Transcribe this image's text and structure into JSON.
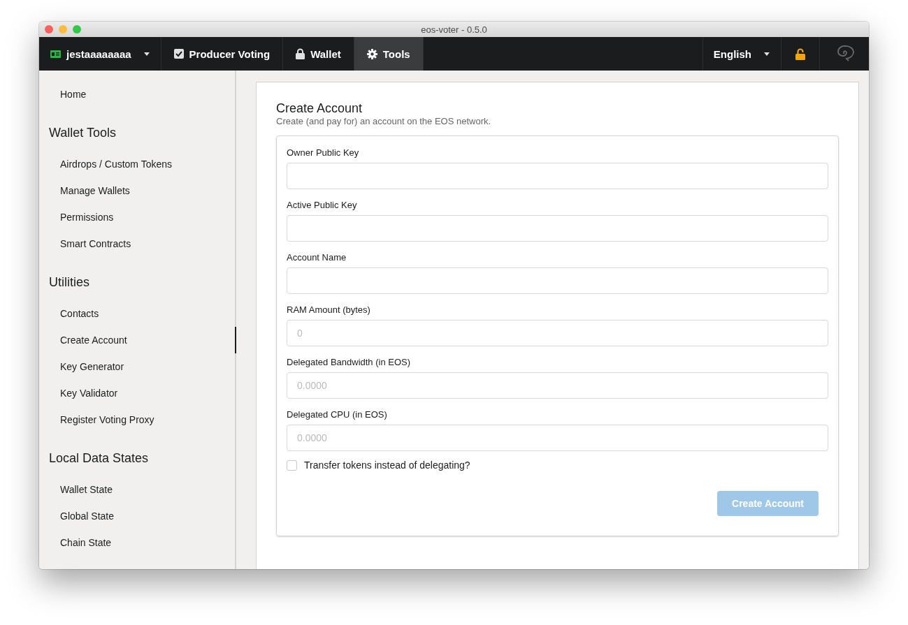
{
  "window": {
    "title": "eos-voter - 0.5.0"
  },
  "nav": {
    "account": "jestaaaaaaaa",
    "tabs": [
      {
        "label": "Producer Voting",
        "kind": "check",
        "selected": false
      },
      {
        "label": "Wallet",
        "kind": "lock",
        "selected": false
      },
      {
        "label": "Tools",
        "kind": "gear",
        "selected": true
      }
    ],
    "language": "English"
  },
  "sidebar": [
    {
      "items": [
        {
          "label": "Home",
          "selected": false
        }
      ]
    },
    {
      "heading": "Wallet Tools",
      "items": [
        {
          "label": "Airdrops / Custom Tokens",
          "selected": false
        },
        {
          "label": "Manage Wallets",
          "selected": false
        },
        {
          "label": "Permissions",
          "selected": false
        },
        {
          "label": "Smart Contracts",
          "selected": false
        }
      ]
    },
    {
      "heading": "Utilities",
      "items": [
        {
          "label": "Contacts",
          "selected": false
        },
        {
          "label": "Create Account",
          "selected": true
        },
        {
          "label": "Key Generator",
          "selected": false
        },
        {
          "label": "Key Validator",
          "selected": false
        },
        {
          "label": "Register Voting Proxy",
          "selected": false
        }
      ]
    },
    {
      "heading": "Local Data States",
      "items": [
        {
          "label": "Wallet State",
          "selected": false
        },
        {
          "label": "Global State",
          "selected": false
        },
        {
          "label": "Chain State",
          "selected": false
        }
      ]
    }
  ],
  "form": {
    "title": "Create Account",
    "subtitle": "Create (and pay for) an account on the EOS network.",
    "fields": [
      {
        "label": "Owner Public Key"
      },
      {
        "label": "Active Public Key"
      },
      {
        "label": "Account Name"
      },
      {
        "label": "RAM Amount (bytes)",
        "placeholder": "0"
      },
      {
        "label": "Delegated Bandwidth (in EOS)",
        "placeholder": "0.0000"
      },
      {
        "label": "Delegated CPU (in EOS)",
        "placeholder": "0.0000"
      }
    ],
    "checkbox": {
      "label": "Transfer tokens instead of delegating?",
      "checked": false
    },
    "button": {
      "label": "Create Account",
      "disabled": true
    }
  }
}
